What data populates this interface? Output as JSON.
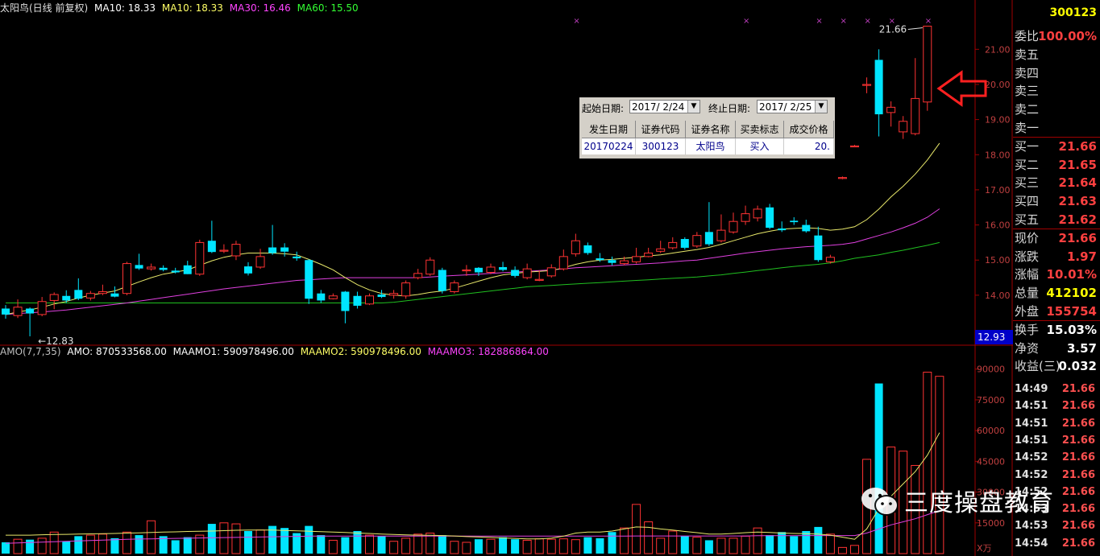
{
  "header": {
    "title": "太阳鸟(日线 前复权)",
    "ma_items": [
      {
        "label": "MA10: 18.33",
        "color": "#ffffff"
      },
      {
        "label": "MA10: 18.33",
        "color": "#ffff66"
      },
      {
        "label": "MA30: 16.46",
        "color": "#ff44ff"
      },
      {
        "label": "MA60: 15.50",
        "color": "#33ff33"
      }
    ]
  },
  "volume_header": {
    "items": [
      {
        "label": "AMO(7,7,35)",
        "color": "#c0c0c0"
      },
      {
        "label": "AMO: 870533568.00",
        "color": "#ffffff"
      },
      {
        "label": "MAAMO1: 590978496.00",
        "color": "#ffffff"
      },
      {
        "label": "MAAMO2: 590978496.00",
        "color": "#ffff66"
      },
      {
        "label": "MAAMO3: 182886864.00",
        "color": "#ff44ff"
      }
    ]
  },
  "colors": {
    "up": "#ff3333",
    "down": "#00e5ff",
    "ma_yellow": "#e8e86a",
    "ma_pink": "#e040e0",
    "ma_green": "#20c020"
  },
  "chart_data": [
    {
      "type": "candlestick",
      "title": "太阳鸟(日线 前复权)",
      "ylim": [
        12.6,
        21.9
      ],
      "y_ticks": [
        "21.00",
        "20.00",
        "19.00",
        "18.00",
        "17.00",
        "16.00",
        "15.00",
        "14.00"
      ],
      "high_label": "21.66",
      "low_label": "12.83",
      "last_price_label": "12.93",
      "candles": [
        [
          13.62,
          13.45,
          13.72,
          13.33
        ],
        [
          13.42,
          13.66,
          13.88,
          13.35
        ],
        [
          13.62,
          13.48,
          13.65,
          12.83
        ],
        [
          13.45,
          13.82,
          13.95,
          13.4
        ],
        [
          13.85,
          14.02,
          14.08,
          13.6
        ],
        [
          13.98,
          13.85,
          14.14,
          13.78
        ],
        [
          14.15,
          13.9,
          14.48,
          13.86
        ],
        [
          13.92,
          14.05,
          14.12,
          13.85
        ],
        [
          14.05,
          14.1,
          14.3,
          14.0
        ],
        [
          14.05,
          13.96,
          14.25,
          13.94
        ],
        [
          14.05,
          14.9,
          14.95,
          14.0
        ],
        [
          14.86,
          14.76,
          15.18,
          14.72
        ],
        [
          14.75,
          14.8,
          14.9,
          14.7
        ],
        [
          14.78,
          14.72,
          14.85,
          14.68
        ],
        [
          14.7,
          14.65,
          14.78,
          14.62
        ],
        [
          14.85,
          14.6,
          14.98,
          14.6
        ],
        [
          14.6,
          15.5,
          15.58,
          14.55
        ],
        [
          15.55,
          15.23,
          16.12,
          15.2
        ],
        [
          15.28,
          15.28,
          15.45,
          15.2
        ],
        [
          15.12,
          15.45,
          15.55,
          15.0
        ],
        [
          14.82,
          14.62,
          14.94,
          14.56
        ],
        [
          14.8,
          15.1,
          15.32,
          14.75
        ],
        [
          15.36,
          15.2,
          16.0,
          15.15
        ],
        [
          15.36,
          15.24,
          15.48,
          15.1
        ],
        [
          15.1,
          15.05,
          15.24,
          14.98
        ],
        [
          15.0,
          13.9,
          15.02,
          13.75
        ],
        [
          14.05,
          13.85,
          14.15,
          13.78
        ],
        [
          13.9,
          13.98,
          14.05,
          13.88
        ],
        [
          14.1,
          13.55,
          14.12,
          13.2
        ],
        [
          13.98,
          13.7,
          14.1,
          13.62
        ],
        [
          13.75,
          13.98,
          14.05,
          13.72
        ],
        [
          14.02,
          13.95,
          14.15,
          13.92
        ],
        [
          14.0,
          14.05,
          14.15,
          13.9
        ],
        [
          13.98,
          14.35,
          14.42,
          13.9
        ],
        [
          14.5,
          14.62,
          14.75,
          14.45
        ],
        [
          14.6,
          15.0,
          15.08,
          14.55
        ],
        [
          14.72,
          14.12,
          14.78,
          14.05
        ],
        [
          14.1,
          14.35,
          14.42,
          14.05
        ],
        [
          14.72,
          14.72,
          14.86,
          14.55
        ],
        [
          14.78,
          14.65,
          14.8,
          14.55
        ],
        [
          14.65,
          14.8,
          14.9,
          14.6
        ],
        [
          14.8,
          14.72,
          14.95,
          14.68
        ],
        [
          14.72,
          14.55,
          14.82,
          14.5
        ],
        [
          14.5,
          14.75,
          14.9,
          14.45
        ],
        [
          14.45,
          14.45,
          14.7,
          14.4
        ],
        [
          14.55,
          14.78,
          14.88,
          14.5
        ],
        [
          14.75,
          15.1,
          15.3,
          14.7
        ],
        [
          15.18,
          15.55,
          15.75,
          15.1
        ],
        [
          15.42,
          15.2,
          15.5,
          15.15
        ],
        [
          15.05,
          15.0,
          15.2,
          14.95
        ],
        [
          15.0,
          14.92,
          15.1,
          14.85
        ],
        [
          14.9,
          14.98,
          15.1,
          14.85
        ],
        [
          14.95,
          15.1,
          15.35,
          14.9
        ],
        [
          15.1,
          15.2,
          15.35,
          15.08
        ],
        [
          15.25,
          15.32,
          15.55,
          15.2
        ],
        [
          15.35,
          15.5,
          15.65,
          15.3
        ],
        [
          15.6,
          15.35,
          15.65,
          15.3
        ],
        [
          15.4,
          15.7,
          15.8,
          15.35
        ],
        [
          15.8,
          15.45,
          16.65,
          15.4
        ],
        [
          15.55,
          15.85,
          16.3,
          15.5
        ],
        [
          15.8,
          16.1,
          16.35,
          15.75
        ],
        [
          16.1,
          16.32,
          16.55,
          16.0
        ],
        [
          16.2,
          16.45,
          16.55,
          16.1
        ],
        [
          16.5,
          15.92,
          16.6,
          15.88
        ],
        [
          15.9,
          15.85,
          16.1,
          15.8
        ],
        [
          16.12,
          16.08,
          16.22,
          16.0
        ],
        [
          16.0,
          15.82,
          16.15,
          15.78
        ],
        [
          15.7,
          15.0,
          15.95,
          14.95
        ],
        [
          14.95,
          15.08,
          15.15,
          14.9
        ],
        [
          17.35,
          17.35,
          17.38,
          17.3
        ],
        [
          18.25,
          18.25,
          18.28,
          18.22
        ],
        [
          20.0,
          20.0,
          20.2,
          19.75
        ],
        [
          20.7,
          19.15,
          21.0,
          18.52
        ],
        [
          19.2,
          19.35,
          19.52,
          18.8
        ],
        [
          18.65,
          18.95,
          19.1,
          18.45
        ],
        [
          18.6,
          19.6,
          20.75,
          18.55
        ],
        [
          19.5,
          21.66,
          21.66,
          19.25
        ]
      ],
      "ma_yellow": [
        13.45,
        13.52,
        13.58,
        13.66,
        13.75,
        13.82,
        13.92,
        14.0,
        14.06,
        14.12,
        14.25,
        14.38,
        14.5,
        14.6,
        14.66,
        14.72,
        14.85,
        14.98,
        15.08,
        15.15,
        15.2,
        15.2,
        15.2,
        15.18,
        15.15,
        15.02,
        14.88,
        14.72,
        14.5,
        14.3,
        14.15,
        14.05,
        14.0,
        13.98,
        14.02,
        14.08,
        14.12,
        14.2,
        14.3,
        14.4,
        14.5,
        14.58,
        14.62,
        14.66,
        14.68,
        14.7,
        14.78,
        14.88,
        14.95,
        15.0,
        15.02,
        15.05,
        15.08,
        15.12,
        15.15,
        15.2,
        15.25,
        15.3,
        15.36,
        15.45,
        15.55,
        15.65,
        15.75,
        15.82,
        15.88,
        15.9,
        15.92,
        15.9,
        15.85,
        15.88,
        15.95,
        16.15,
        16.45,
        16.8,
        17.1,
        17.45,
        17.85,
        18.33
      ],
      "ma_pink": [
        13.45,
        13.48,
        13.5,
        13.52,
        13.55,
        13.58,
        13.62,
        13.66,
        13.7,
        13.74,
        13.78,
        13.83,
        13.88,
        13.93,
        13.98,
        14.03,
        14.08,
        14.13,
        14.18,
        14.22,
        14.26,
        14.3,
        14.34,
        14.38,
        14.42,
        14.44,
        14.46,
        14.48,
        14.5,
        14.5,
        14.5,
        14.5,
        14.5,
        14.5,
        14.5,
        14.52,
        14.54,
        14.56,
        14.58,
        14.6,
        14.62,
        14.64,
        14.66,
        14.68,
        14.7,
        14.72,
        14.75,
        14.78,
        14.8,
        14.82,
        14.84,
        14.86,
        14.88,
        14.9,
        14.92,
        14.95,
        14.98,
        15.0,
        15.05,
        15.1,
        15.15,
        15.2,
        15.24,
        15.28,
        15.32,
        15.35,
        15.38,
        15.4,
        15.42,
        15.45,
        15.5,
        15.6,
        15.7,
        15.8,
        15.92,
        16.05,
        16.22,
        16.46
      ],
      "ma_green": [
        13.78,
        13.78,
        13.78,
        13.78,
        13.78,
        13.78,
        13.78,
        13.78,
        13.78,
        13.78,
        13.78,
        13.78,
        13.78,
        13.78,
        13.78,
        13.78,
        13.78,
        13.78,
        13.78,
        13.78,
        13.78,
        13.78,
        13.78,
        13.78,
        13.78,
        13.78,
        13.78,
        13.78,
        13.78,
        13.78,
        13.78,
        13.78,
        13.8,
        13.84,
        13.88,
        13.92,
        13.96,
        14.0,
        14.04,
        14.08,
        14.12,
        14.16,
        14.2,
        14.24,
        14.26,
        14.28,
        14.3,
        14.32,
        14.34,
        14.36,
        14.38,
        14.4,
        14.42,
        14.44,
        14.46,
        14.48,
        14.5,
        14.52,
        14.55,
        14.58,
        14.62,
        14.66,
        14.7,
        14.74,
        14.78,
        14.82,
        14.85,
        14.88,
        14.92,
        14.98,
        15.05,
        15.1,
        15.15,
        15.22,
        15.28,
        15.35,
        15.42,
        15.5
      ]
    },
    {
      "type": "bar",
      "title": "AMO(7,7,35)",
      "ylim": [
        0,
        95000
      ],
      "y_ticks": [
        "90000",
        "75000",
        "60000",
        "45000",
        "30000",
        "15000"
      ],
      "unit_label": "X万",
      "values": [
        5500,
        7000,
        6800,
        7500,
        10500,
        6000,
        8500,
        9000,
        9500,
        7500,
        10500,
        9000,
        16000,
        8500,
        6500,
        8000,
        9000,
        14500,
        15000,
        14500,
        11000,
        11500,
        13500,
        12500,
        10000,
        13500,
        9000,
        6500,
        8000,
        11000,
        9000,
        8500,
        6000,
        7500,
        9500,
        10000,
        9000,
        6000,
        5500,
        7000,
        7000,
        8000,
        7000,
        6500,
        7200,
        7000,
        7200,
        6800,
        8000,
        7500,
        10500,
        12500,
        24000,
        15500,
        7500,
        11000,
        8500,
        8000,
        6500,
        7500,
        7500,
        8500,
        12500,
        9000,
        10500,
        8500,
        11000,
        13000,
        9500,
        3000,
        4000,
        46000,
        83000,
        52000,
        50000,
        43000,
        88500,
        86500
      ],
      "ma_yellow": [
        9000,
        9000,
        9000,
        9200,
        9300,
        9400,
        9500,
        9600,
        9700,
        9800,
        10000,
        10100,
        10300,
        10500,
        10600,
        10800,
        10900,
        11000,
        11200,
        11400,
        11500,
        11500,
        11500,
        11300,
        11100,
        10900,
        10700,
        10500,
        10300,
        10000,
        9800,
        9500,
        9300,
        9100,
        9000,
        8900,
        8800,
        8600,
        8300,
        8100,
        7900,
        7600,
        7400,
        7200,
        7200,
        7500,
        8500,
        10000,
        10500,
        10500,
        11000,
        12000,
        13000,
        12800,
        12000,
        11500,
        10800,
        10200,
        9500,
        9500,
        9800,
        10200,
        10500,
        10300,
        10000,
        9800,
        9700,
        9500,
        9000,
        8000,
        7000,
        12000,
        22000,
        28000,
        34000,
        40000,
        48000,
        59000
      ],
      "ma_pink": [
        5000,
        5200,
        5400,
        5600,
        5800,
        6000,
        6200,
        6400,
        6600,
        6800,
        7000,
        7100,
        7200,
        7300,
        7400,
        7500,
        7600,
        7700,
        7800,
        7900,
        8000,
        8100,
        8200,
        8300,
        8400,
        8500,
        8500,
        8500,
        8500,
        8500,
        8500,
        8500,
        8500,
        8500,
        8500,
        8500,
        8500,
        8500,
        8500,
        8500,
        8500,
        8500,
        8500,
        8500,
        8500,
        8500,
        8500,
        8500,
        8500,
        8500,
        8500,
        8500,
        8600,
        8600,
        8600,
        8600,
        8600,
        8600,
        8600,
        8600,
        8600,
        8600,
        8700,
        8700,
        8700,
        8700,
        8800,
        8800,
        8800,
        8800,
        8800,
        10000,
        12000,
        14000,
        15500,
        17000,
        19000,
        21000
      ]
    }
  ],
  "panel": {
    "code": "300123",
    "rows": [
      {
        "label": "委比",
        "value": "100.00%",
        "color": "#ff4040"
      },
      {
        "label": "卖五",
        "value": "",
        "color": "#ff4040"
      },
      {
        "label": "卖四",
        "value": "",
        "color": "#ff4040"
      },
      {
        "label": "卖三",
        "value": "",
        "color": "#ff4040"
      },
      {
        "label": "卖二",
        "value": "",
        "color": "#ff4040"
      },
      {
        "label": "卖一",
        "value": "",
        "color": "#ff4040"
      },
      {
        "label": "买一",
        "value": "21.66",
        "color": "#ff4040"
      },
      {
        "label": "买二",
        "value": "21.65",
        "color": "#ff4040"
      },
      {
        "label": "买三",
        "value": "21.64",
        "color": "#ff4040"
      },
      {
        "label": "买四",
        "value": "21.63",
        "color": "#ff4040"
      },
      {
        "label": "买五",
        "value": "21.62",
        "color": "#ff4040"
      },
      {
        "label": "现价",
        "value": "21.66",
        "color": "#ff4040"
      },
      {
        "label": "涨跌",
        "value": "1.97",
        "color": "#ff4040"
      },
      {
        "label": "涨幅",
        "value": "10.01%",
        "color": "#ff4040"
      },
      {
        "label": "总量",
        "value": "412102",
        "color": "#ffff00"
      },
      {
        "label": "外盘",
        "value": "155754",
        "color": "#ff4040"
      },
      {
        "label": "换手",
        "value": "15.03%",
        "color": "#ffffff"
      },
      {
        "label": "净资",
        "value": "3.57",
        "color": "#ffffff"
      },
      {
        "label": "收益(三)",
        "value": "0.032",
        "color": "#ffffff"
      }
    ],
    "ticks": [
      {
        "time": "14:49",
        "price": "21.66"
      },
      {
        "time": "14:51",
        "price": "21.66"
      },
      {
        "time": "14:51",
        "price": "21.66"
      },
      {
        "time": "14:51",
        "price": "21.66"
      },
      {
        "time": "14:52",
        "price": "21.66"
      },
      {
        "time": "14:52",
        "price": "21.66"
      },
      {
        "time": "14:52",
        "price": "21.66"
      },
      {
        "time": "14:53",
        "price": "21.66"
      },
      {
        "time": "14:53",
        "price": "21.66"
      },
      {
        "time": "14:54",
        "price": "21.66"
      }
    ]
  },
  "trade_dialog": {
    "start_label": "起始日期:",
    "start_value": "2017/ 2/24",
    "end_label": "终止日期:",
    "end_value": "2017/ 2/25",
    "columns": [
      "发生日期",
      "证券代码",
      "证券名称",
      "买卖标志",
      "成交价格"
    ],
    "row": [
      "20170224",
      "300123",
      "太阳鸟",
      "买入",
      "20."
    ]
  },
  "watermark": {
    "text": "三度操盘教育"
  }
}
